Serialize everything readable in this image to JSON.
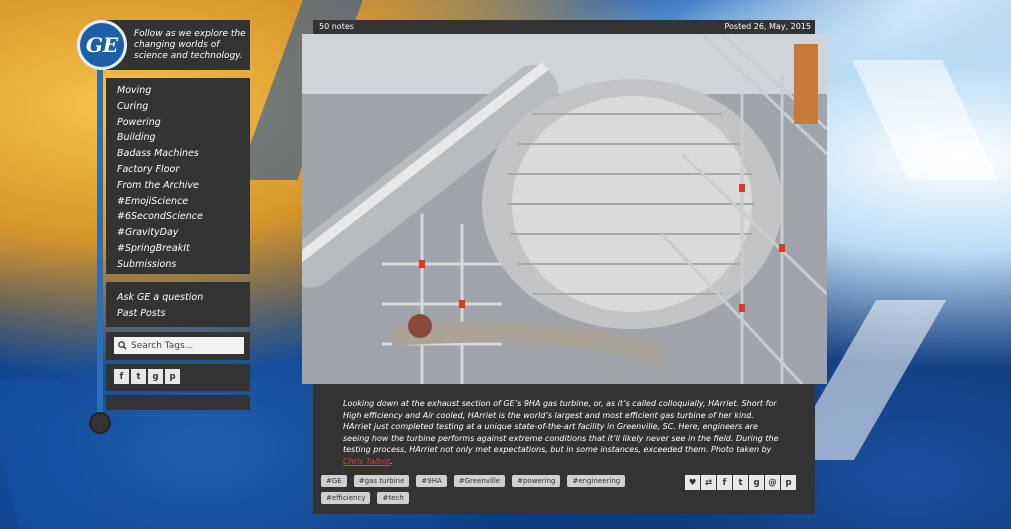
{
  "brand": {
    "logo_text": "GE",
    "tagline": "Follow as we explore the changing worlds of science and technology."
  },
  "nav": {
    "items": [
      {
        "label": "Moving"
      },
      {
        "label": "Curing"
      },
      {
        "label": "Powering"
      },
      {
        "label": "Building"
      },
      {
        "label": "Badass Machines"
      },
      {
        "label": "Factory Floor"
      },
      {
        "label": "From the Archive"
      },
      {
        "label": "#EmojiScience"
      },
      {
        "label": "#6SecondScience"
      },
      {
        "label": "#GravityDay"
      },
      {
        "label": "#SpringBreakIt"
      },
      {
        "label": "Submissions"
      }
    ],
    "secondary": [
      {
        "label": "Ask GE a question"
      },
      {
        "label": "Past Posts"
      }
    ]
  },
  "search": {
    "placeholder": "Search Tags...",
    "icon": "search-icon"
  },
  "sidebar_social": [
    {
      "name": "facebook-icon",
      "glyph": "f"
    },
    {
      "name": "twitter-icon",
      "glyph": "t"
    },
    {
      "name": "google-plus-icon",
      "glyph": "g"
    },
    {
      "name": "pinterest-icon",
      "glyph": "p"
    }
  ],
  "post": {
    "notes": "50 notes",
    "posted": "Posted 26, May, 2015",
    "caption": "Looking down at the exhaust section of GE’s 9HA gas turbine, or, as it’s called colloquially, HArriet. Short for High efficiency and Air cooled, HArriet is the world’s largest and most efficient gas turbine of her kind. HArriet just completed testing at a unique state-of-the-art facility in Greenville, SC. Here, engineers are seeing how the turbine performs against extreme conditions that it’ll likely never see in the field. During the testing process, HArriet not only met expectations, but in some instances, exceeded them. Photo taken by ",
    "author": "Chris Talbot",
    "caption_end": ".",
    "tags": [
      "#GE",
      "#gas turbine",
      "#9HA",
      "#Greenville",
      "#powering",
      "#engineering",
      "#efficiency",
      "#tech"
    ]
  },
  "share_icons": [
    {
      "name": "heart-icon",
      "glyph": "♥"
    },
    {
      "name": "reblog-icon",
      "glyph": "⇄"
    },
    {
      "name": "facebook-icon",
      "glyph": "f"
    },
    {
      "name": "twitter-icon",
      "glyph": "t"
    },
    {
      "name": "google-plus-icon",
      "glyph": "g"
    },
    {
      "name": "tumblr-icon",
      "glyph": "@"
    },
    {
      "name": "pinterest-icon",
      "glyph": "p"
    }
  ],
  "colors": {
    "panel": "#333333",
    "accent_blue": "#2c6fb7",
    "link_red": "#e43a3a"
  }
}
